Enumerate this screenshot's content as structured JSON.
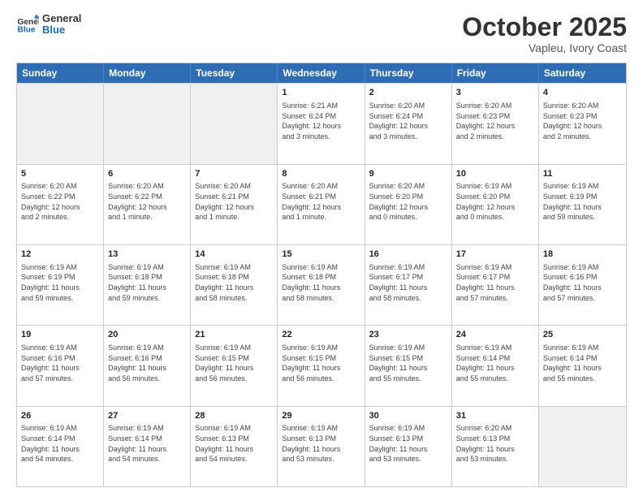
{
  "logo": {
    "line1": "General",
    "line2": "Blue"
  },
  "title": "October 2025",
  "subtitle": "Vapleu, Ivory Coast",
  "header_days": [
    "Sunday",
    "Monday",
    "Tuesday",
    "Wednesday",
    "Thursday",
    "Friday",
    "Saturday"
  ],
  "rows": [
    [
      {
        "day": "",
        "info": ""
      },
      {
        "day": "",
        "info": ""
      },
      {
        "day": "",
        "info": ""
      },
      {
        "day": "1",
        "info": "Sunrise: 6:21 AM\nSunset: 6:24 PM\nDaylight: 12 hours\nand 3 minutes."
      },
      {
        "day": "2",
        "info": "Sunrise: 6:20 AM\nSunset: 6:24 PM\nDaylight: 12 hours\nand 3 minutes."
      },
      {
        "day": "3",
        "info": "Sunrise: 6:20 AM\nSunset: 6:23 PM\nDaylight: 12 hours\nand 2 minutes."
      },
      {
        "day": "4",
        "info": "Sunrise: 6:20 AM\nSunset: 6:23 PM\nDaylight: 12 hours\nand 2 minutes."
      }
    ],
    [
      {
        "day": "5",
        "info": "Sunrise: 6:20 AM\nSunset: 6:22 PM\nDaylight: 12 hours\nand 2 minutes."
      },
      {
        "day": "6",
        "info": "Sunrise: 6:20 AM\nSunset: 6:22 PM\nDaylight: 12 hours\nand 1 minute."
      },
      {
        "day": "7",
        "info": "Sunrise: 6:20 AM\nSunset: 6:21 PM\nDaylight: 12 hours\nand 1 minute."
      },
      {
        "day": "8",
        "info": "Sunrise: 6:20 AM\nSunset: 6:21 PM\nDaylight: 12 hours\nand 1 minute."
      },
      {
        "day": "9",
        "info": "Sunrise: 6:20 AM\nSunset: 6:20 PM\nDaylight: 12 hours\nand 0 minutes."
      },
      {
        "day": "10",
        "info": "Sunrise: 6:19 AM\nSunset: 6:20 PM\nDaylight: 12 hours\nand 0 minutes."
      },
      {
        "day": "11",
        "info": "Sunrise: 6:19 AM\nSunset: 6:19 PM\nDaylight: 11 hours\nand 59 minutes."
      }
    ],
    [
      {
        "day": "12",
        "info": "Sunrise: 6:19 AM\nSunset: 6:19 PM\nDaylight: 11 hours\nand 59 minutes."
      },
      {
        "day": "13",
        "info": "Sunrise: 6:19 AM\nSunset: 6:18 PM\nDaylight: 11 hours\nand 59 minutes."
      },
      {
        "day": "14",
        "info": "Sunrise: 6:19 AM\nSunset: 6:18 PM\nDaylight: 11 hours\nand 58 minutes."
      },
      {
        "day": "15",
        "info": "Sunrise: 6:19 AM\nSunset: 6:18 PM\nDaylight: 11 hours\nand 58 minutes."
      },
      {
        "day": "16",
        "info": "Sunrise: 6:19 AM\nSunset: 6:17 PM\nDaylight: 11 hours\nand 58 minutes."
      },
      {
        "day": "17",
        "info": "Sunrise: 6:19 AM\nSunset: 6:17 PM\nDaylight: 11 hours\nand 57 minutes."
      },
      {
        "day": "18",
        "info": "Sunrise: 6:19 AM\nSunset: 6:16 PM\nDaylight: 11 hours\nand 57 minutes."
      }
    ],
    [
      {
        "day": "19",
        "info": "Sunrise: 6:19 AM\nSunset: 6:16 PM\nDaylight: 11 hours\nand 57 minutes."
      },
      {
        "day": "20",
        "info": "Sunrise: 6:19 AM\nSunset: 6:16 PM\nDaylight: 11 hours\nand 56 minutes."
      },
      {
        "day": "21",
        "info": "Sunrise: 6:19 AM\nSunset: 6:15 PM\nDaylight: 11 hours\nand 56 minutes."
      },
      {
        "day": "22",
        "info": "Sunrise: 6:19 AM\nSunset: 6:15 PM\nDaylight: 11 hours\nand 56 minutes."
      },
      {
        "day": "23",
        "info": "Sunrise: 6:19 AM\nSunset: 6:15 PM\nDaylight: 11 hours\nand 55 minutes."
      },
      {
        "day": "24",
        "info": "Sunrise: 6:19 AM\nSunset: 6:14 PM\nDaylight: 11 hours\nand 55 minutes."
      },
      {
        "day": "25",
        "info": "Sunrise: 6:19 AM\nSunset: 6:14 PM\nDaylight: 11 hours\nand 55 minutes."
      }
    ],
    [
      {
        "day": "26",
        "info": "Sunrise: 6:19 AM\nSunset: 6:14 PM\nDaylight: 11 hours\nand 54 minutes."
      },
      {
        "day": "27",
        "info": "Sunrise: 6:19 AM\nSunset: 6:14 PM\nDaylight: 11 hours\nand 54 minutes."
      },
      {
        "day": "28",
        "info": "Sunrise: 6:19 AM\nSunset: 6:13 PM\nDaylight: 11 hours\nand 54 minutes."
      },
      {
        "day": "29",
        "info": "Sunrise: 6:19 AM\nSunset: 6:13 PM\nDaylight: 11 hours\nand 53 minutes."
      },
      {
        "day": "30",
        "info": "Sunrise: 6:19 AM\nSunset: 6:13 PM\nDaylight: 11 hours\nand 53 minutes."
      },
      {
        "day": "31",
        "info": "Sunrise: 6:20 AM\nSunset: 6:13 PM\nDaylight: 11 hours\nand 53 minutes."
      },
      {
        "day": "",
        "info": ""
      }
    ]
  ]
}
